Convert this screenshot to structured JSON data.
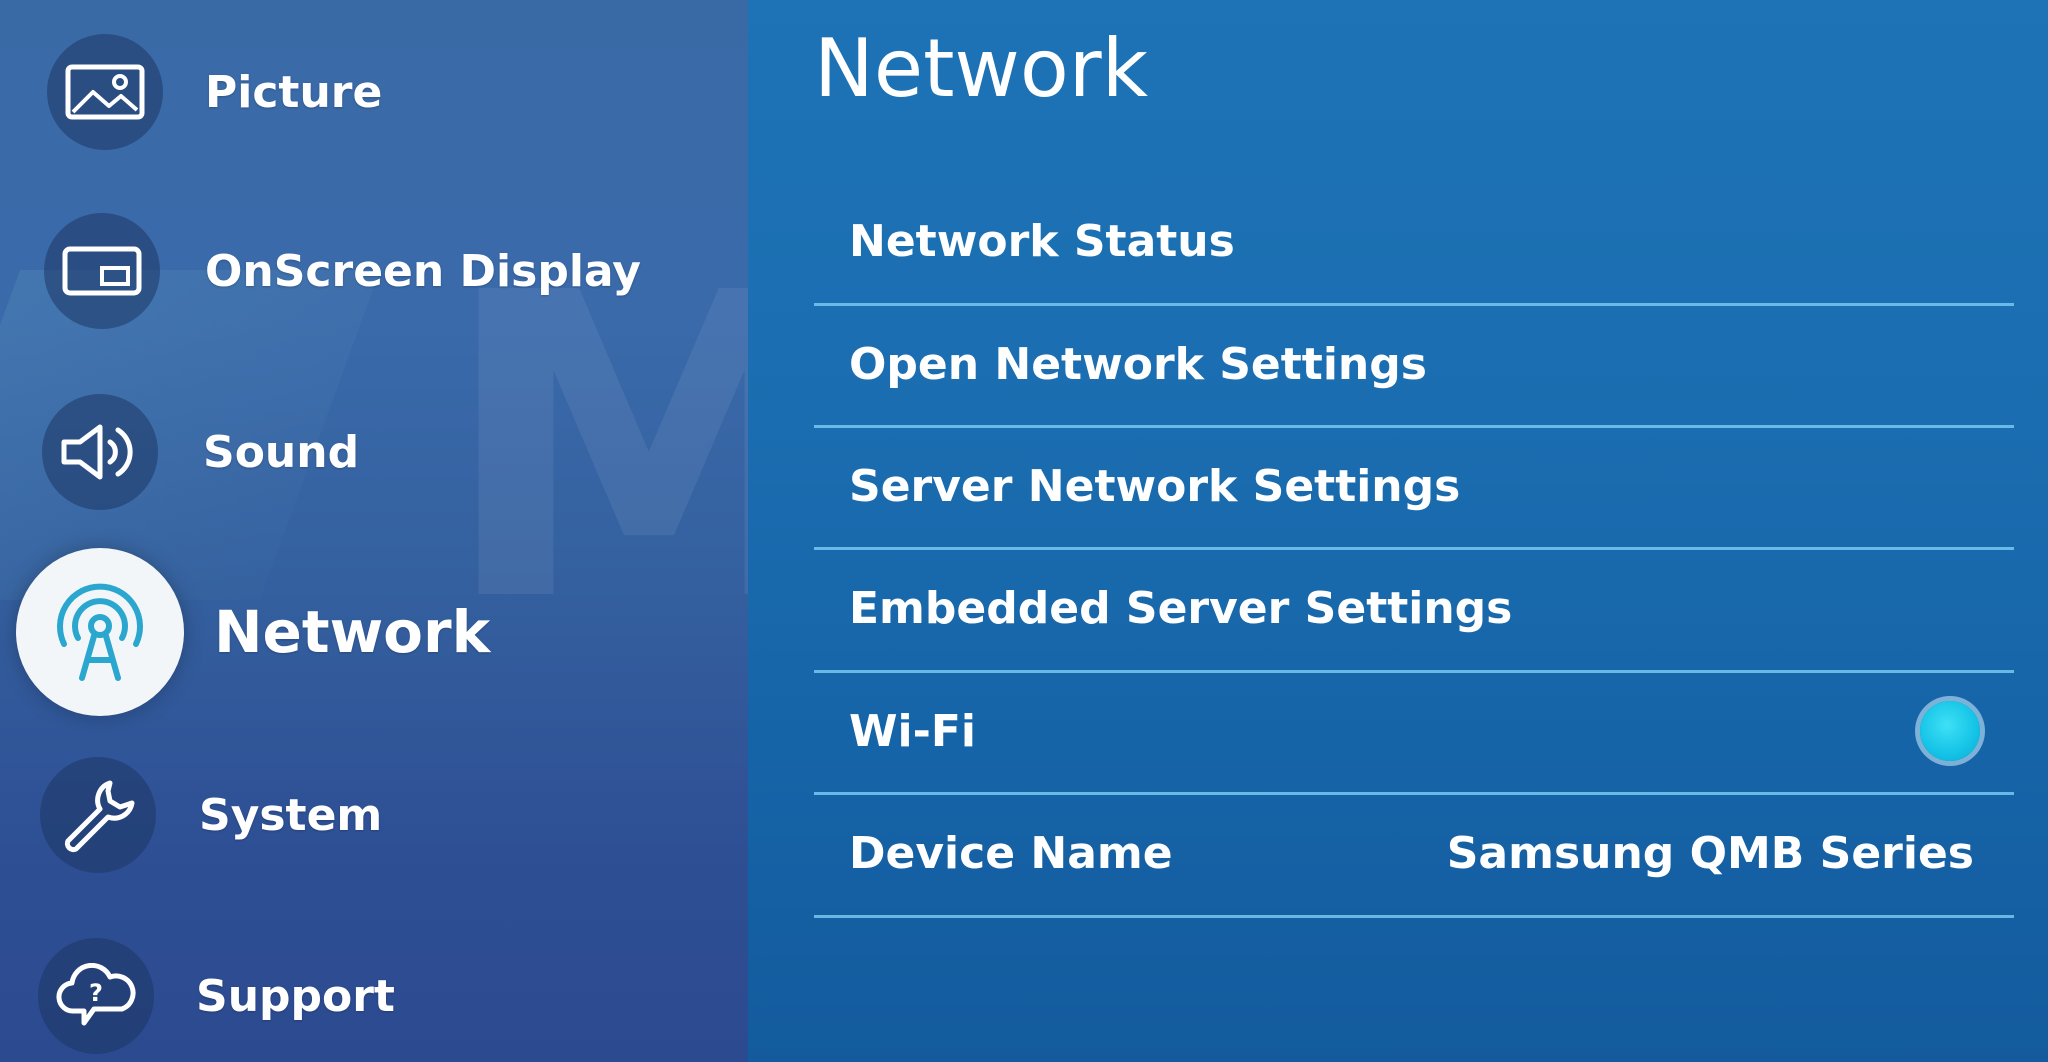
{
  "sidebar": {
    "items": [
      {
        "label": "Picture",
        "icon": "picture-icon",
        "active": false
      },
      {
        "label": "OnScreen Display",
        "icon": "onscreen-display-icon",
        "active": false
      },
      {
        "label": "Sound",
        "icon": "speaker-icon",
        "active": false
      },
      {
        "label": "Network",
        "icon": "antenna-icon",
        "active": true
      },
      {
        "label": "System",
        "icon": "wrench-icon",
        "active": false
      },
      {
        "label": "Support",
        "icon": "help-cloud-icon",
        "active": false
      }
    ]
  },
  "panel": {
    "title": "Network",
    "rows": [
      {
        "label": "Network Status"
      },
      {
        "label": "Open Network Settings"
      },
      {
        "label": "Server Network Settings"
      },
      {
        "label": "Embedded Server Settings"
      },
      {
        "label": "Wi-Fi",
        "toggle": "on"
      },
      {
        "label": "Device Name",
        "value": "Samsung QMB Series"
      }
    ]
  },
  "colors": {
    "sidebar_bg": "#3a6aa6",
    "panel_bg": "#1a6db0",
    "divider": "#78c8f0",
    "toggle_on": "#14c3e6",
    "active_icon_bg": "#f3f6f9",
    "active_icon_stroke": "#2ba7cf"
  }
}
